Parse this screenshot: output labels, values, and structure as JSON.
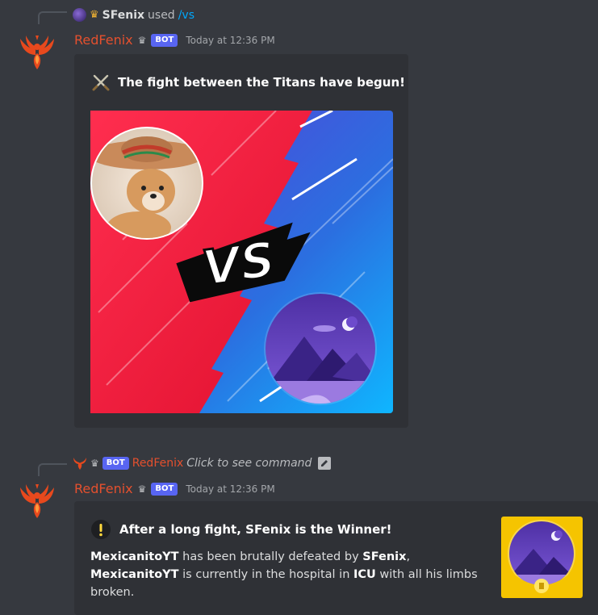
{
  "message1": {
    "reply": {
      "user": "SFenix",
      "used_text": "used",
      "command": "/vs"
    },
    "author": "RedFenix",
    "bot_badge": "BOT",
    "timestamp": "Today at 12:36 PM",
    "embed": {
      "title": "The fight between the Titans have begun!",
      "vs_text": "VS"
    }
  },
  "message2": {
    "reply": {
      "bot_badge": "BOT",
      "user": "RedFenix",
      "hint": "Click to see command"
    },
    "author": "RedFenix",
    "bot_badge": "BOT",
    "timestamp": "Today at 12:36 PM",
    "embed": {
      "title": "After a long fight, SFenix is the Winner!",
      "desc": {
        "loser": "MexicanitoYT",
        "text1": " has been brutally defeated by ",
        "winner": "SFenix",
        "punct": ",",
        "loser2": "MexicanitoYT",
        "text2": " is currently in the hospital in ",
        "ward": "ICU",
        "text3": " with all his limbs",
        "text4": "broken."
      }
    }
  },
  "colors": {
    "background": "#36393f",
    "embed_bg": "#2f3136",
    "author": "#e4502e",
    "bot_badge": "#5865f2",
    "link": "#00a8fc",
    "thumbnail_border": "#f5c400"
  },
  "icons": {
    "swords": "crossed-swords-icon",
    "alert": "exclamation-icon",
    "crown": "crown-icon",
    "edit": "edit-icon"
  }
}
